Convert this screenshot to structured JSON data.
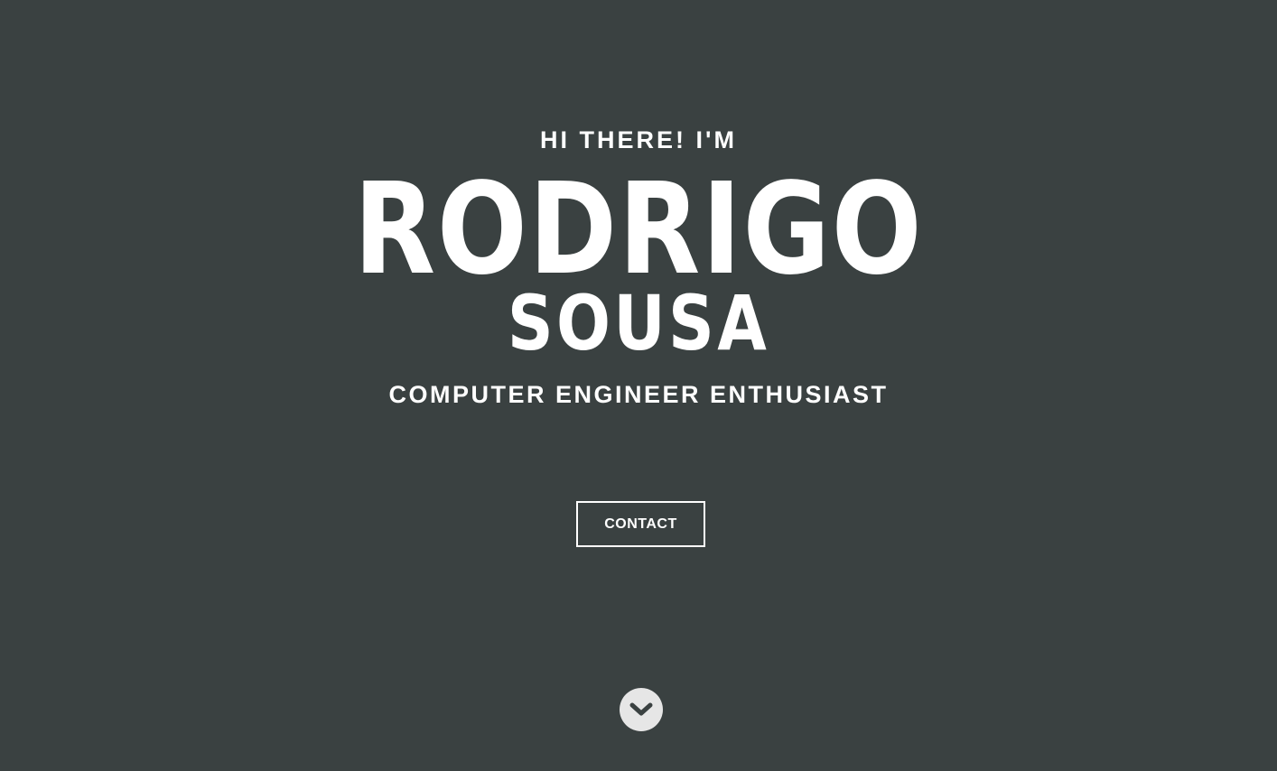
{
  "hero": {
    "greeting": "HI THERE! I'M",
    "first_name": "RODRIGO",
    "last_name": "SOUSA",
    "subtitle": "COMPUTER ENGINEER ENTHUSIAST",
    "contact_label": "CONTACT",
    "scroll_icon": "chevron-down-icon"
  },
  "colors": {
    "background": "#3a4141",
    "text": "#ffffff",
    "scroll_button": "#e6e6e6",
    "scroll_chevron": "#3a4141"
  }
}
